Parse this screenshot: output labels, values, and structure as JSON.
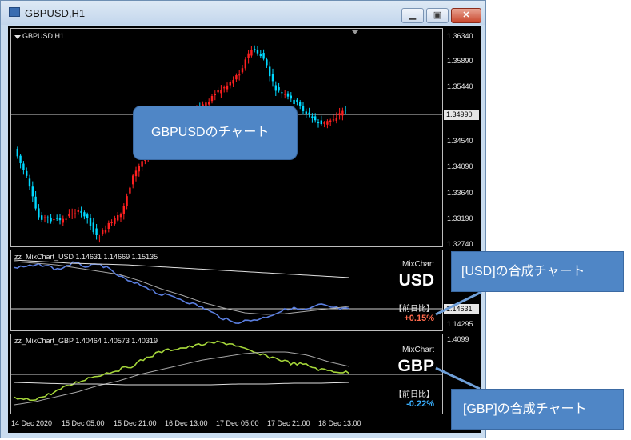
{
  "window": {
    "title": "GBPUSD,H1",
    "minimize_label": "▁",
    "maximize_label": "▣",
    "close_label": "✕"
  },
  "main_chart": {
    "label": "GBPUSD,H1",
    "price_ticks": [
      "1.36340",
      "1.35890",
      "1.35440",
      "1.34990",
      "1.34540",
      "1.34090",
      "1.33640",
      "1.33190",
      "1.32740"
    ],
    "current_price": "1.34990",
    "up_color": "#00d8ff",
    "down_color": "#ff2020"
  },
  "usd_pane": {
    "label": "zz_MixChart_USD 1.14631 1.14669 1.15135",
    "mix_title": "MixChart",
    "currency": "USD",
    "prev_label": "【前日比】",
    "change": "+0.15%",
    "change_color": "#ff6a4d",
    "line_color": "#5b7fe0",
    "price_tag": "1.14631",
    "tick_low": "1.14295"
  },
  "gbp_pane": {
    "label": "zz_MixChart_GBP 1.40464 1.40573 1.40319",
    "mix_title": "MixChart",
    "currency": "GBP",
    "prev_label": "【前日比】",
    "change": "-0.22%",
    "change_color": "#3ab0ff",
    "line_color": "#a5d63a",
    "tick_high": "1.4099"
  },
  "time_axis": [
    "14 Dec 2020",
    "15 Dec 05:00",
    "15 Dec 21:00",
    "16 Dec 13:00",
    "17 Dec 05:00",
    "17 Dec 21:00",
    "18 Dec 13:00"
  ],
  "callouts": {
    "main": "GBPUSDのチャート",
    "usd": "[USD]の合成チャート",
    "gbp": "[GBP]の合成チャート"
  }
}
